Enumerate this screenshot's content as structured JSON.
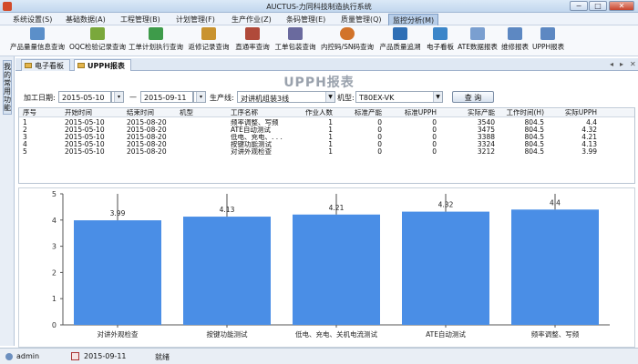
{
  "window": {
    "title": "AUCTUS-力同科技制造执行系统",
    "min": "−",
    "max": "□",
    "close": "✕"
  },
  "menu": [
    {
      "label": "系统设置(S)"
    },
    {
      "label": "基础数据(A)"
    },
    {
      "label": "工程管理(B)"
    },
    {
      "label": "计划管理(F)"
    },
    {
      "label": "生产作业(Z)"
    },
    {
      "label": "条码管理(E)"
    },
    {
      "label": "质量管理(Q)"
    },
    {
      "label": "监控分析(M)"
    }
  ],
  "toolbar": [
    {
      "label": "产品量量信息查询",
      "icon": "grid-icon",
      "color": "#5b8fc9"
    },
    {
      "label": "OQC检验记录查询",
      "icon": "chart-icon",
      "color": "#7aa83b"
    },
    {
      "label": "工单计划执行查询",
      "icon": "bar-chart-icon",
      "color": "#3e9b4a"
    },
    {
      "label": "返修记录查询",
      "icon": "bar-chart-icon",
      "color": "#c9932f"
    },
    {
      "label": "直通率查询",
      "icon": "report-icon",
      "color": "#b04a3a"
    },
    {
      "label": "工单包装查询",
      "icon": "package-icon",
      "color": "#6a6a9e"
    },
    {
      "label": "内控码/SN码查询",
      "icon": "pie-icon",
      "color": "#d2732a"
    },
    {
      "label": "产品质量追溯",
      "icon": "line-chart-icon",
      "color": "#7a7a7a"
    },
    {
      "label": "电子看板",
      "icon": "network-icon",
      "color": "#2f6fb5"
    },
    {
      "label": "ATE数据报表",
      "icon": "board-icon",
      "color": "#3c86c9"
    },
    {
      "label": "维修报表",
      "icon": "chart-icon",
      "color": "#7a9fd0"
    },
    {
      "label": "UPPH报表",
      "icon": "chart-icon",
      "color": "#5d88c2"
    }
  ],
  "leftrail": {
    "label": "我的常用功能"
  },
  "tabs": [
    {
      "label": "电子看板"
    },
    {
      "label": "UPPH报表"
    }
  ],
  "tabstrip_controls": {
    "left": "◂",
    "right": "▸",
    "close": "✕"
  },
  "report": {
    "title": "UPPH报表"
  },
  "filters": {
    "date_label": "加工日期:",
    "date_from": "2015-05-10",
    "date_sep": "—",
    "date_to": "2015-09-11",
    "line_label": "生产线:",
    "line_value": "对讲机组装3线",
    "model_label": "机型:",
    "model_value": "T80EX-VK",
    "query_button": "查 询"
  },
  "table": {
    "columns": [
      "序号",
      "开始时间",
      "结束时间",
      "机型",
      "工序名称",
      "作业人数",
      "标准产能",
      "标准UPPH",
      "实际产能",
      "工作时间(H)",
      "实际UPPH"
    ],
    "rows": [
      [
        "1",
        "2015-05-10",
        "2015-08-20",
        "",
        "频率调整、写频",
        "1",
        "0",
        "0",
        "3540",
        "804.5",
        "4.4"
      ],
      [
        "2",
        "2015-05-10",
        "2015-08-20",
        "",
        "ATE自动测试",
        "1",
        "0",
        "0",
        "3475",
        "804.5",
        "4.32"
      ],
      [
        "3",
        "2015-05-10",
        "2015-08-20",
        "",
        "低电、充电、. . .",
        "1",
        "0",
        "0",
        "3388",
        "804.5",
        "4.21"
      ],
      [
        "4",
        "2015-05-10",
        "2015-08-20",
        "",
        "按键功能测试",
        "1",
        "0",
        "0",
        "3324",
        "804.5",
        "4.13"
      ],
      [
        "5",
        "2015-05-10",
        "2015-08-20",
        "",
        "对讲外观检查",
        "1",
        "0",
        "0",
        "3212",
        "804.5",
        "3.99"
      ]
    ]
  },
  "chart_data": {
    "type": "bar",
    "categories": [
      "对讲外观检查",
      "按键功能测试",
      "低电、充电、关机电流测试",
      "ATE自动测试",
      "频率调整、写频"
    ],
    "values": [
      3.99,
      4.13,
      4.21,
      4.32,
      4.4
    ],
    "value_labels": [
      "3.99",
      "4.13",
      "4.21",
      "4.32",
      "4.4"
    ],
    "ylim": [
      0,
      5
    ],
    "yticks": [
      "0",
      "1",
      "2",
      "3",
      "4",
      "5"
    ],
    "bar_color": "#4a8ee6",
    "grid": false,
    "legend": "none"
  },
  "status": {
    "user": "admin",
    "date": "2015-09-11",
    "state": "就绪"
  }
}
